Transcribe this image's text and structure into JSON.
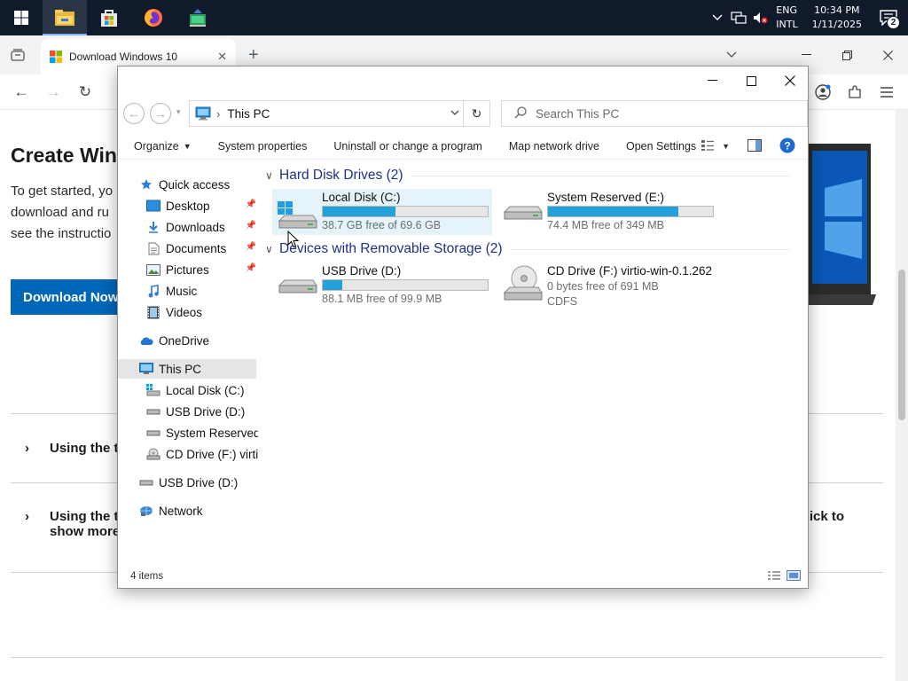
{
  "taskbar": {
    "apps": [
      {
        "icon": "file-explorer-icon",
        "active": true
      },
      {
        "icon": "microsoft-store-icon",
        "active": false
      },
      {
        "icon": "firefox-icon",
        "active": false
      },
      {
        "icon": "app-icon",
        "active": false
      }
    ],
    "lang_line1": "ENG",
    "lang_line2": "INTL",
    "time": "10:34 PM",
    "date": "1/11/2025",
    "notification_count": "2"
  },
  "browser": {
    "tab_title": "Download Windows 10",
    "page": {
      "heading": "Create Win",
      "paragraph_lines": [
        "To get started, yo",
        "download and ru",
        "see the instructio"
      ],
      "download_button": "Download Now",
      "accordion": [
        {
          "label": "Using the t",
          "label2": ""
        },
        {
          "label": "Using the t",
          "label2": "show more"
        }
      ],
      "accordion_right_text": "ick to"
    }
  },
  "explorer": {
    "address": "This PC",
    "search_placeholder": "Search This PC",
    "commands": [
      {
        "label": "Organize",
        "dropdown": true
      },
      {
        "label": "System properties",
        "dropdown": false
      },
      {
        "label": "Uninstall or change a program",
        "dropdown": false
      },
      {
        "label": "Map network drive",
        "dropdown": false
      },
      {
        "label": "Open Settings",
        "dropdown": false
      }
    ],
    "nav": {
      "quick_access": "Quick access",
      "desktop": "Desktop",
      "downloads": "Downloads",
      "documents": "Documents",
      "pictures": "Pictures",
      "music": "Music",
      "videos": "Videos",
      "onedrive": "OneDrive",
      "this_pc": "This PC",
      "local_disk": "Local Disk (C:)",
      "usb_drive": "USB Drive (D:)",
      "system_reserved": "System Reserved",
      "cd_drive": "CD Drive (F:) virtio",
      "usb_drive_root": "USB Drive (D:)",
      "network": "Network"
    },
    "groups": {
      "hard_disks": "Hard Disk Drives (2)",
      "removable": "Devices with Removable Storage (2)"
    },
    "drives": {
      "c": {
        "name": "Local Disk (C:)",
        "free": "38.7 GB free of 69.6 GB",
        "used_fraction": 0.44
      },
      "e": {
        "name": "System Reserved (E:)",
        "free": "74.4 MB free of 349 MB",
        "used_fraction": 0.79
      },
      "d": {
        "name": "USB Drive (D:)",
        "free": "88.1 MB free of 99.9 MB",
        "used_fraction": 0.12
      },
      "f": {
        "name": "CD Drive (F:) virtio-win-0.1.262",
        "free": "0 bytes free of 691 MB",
        "fs": "CDFS"
      }
    },
    "status": "4 items"
  },
  "colors": {
    "taskbar": "#101a2b",
    "accent_blue": "#0067b8",
    "drive_fill": "#26a0da",
    "group_header": "#1e3287"
  }
}
